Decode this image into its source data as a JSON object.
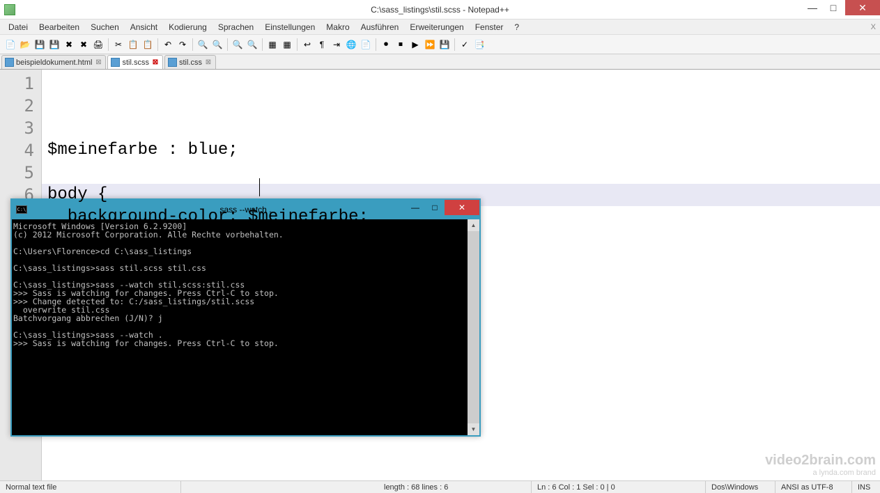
{
  "window": {
    "title": "C:\\sass_listings\\stil.scss - Notepad++"
  },
  "menu": {
    "items": [
      "Datei",
      "Bearbeiten",
      "Suchen",
      "Ansicht",
      "Kodierung",
      "Sprachen",
      "Einstellungen",
      "Makro",
      "Ausführen",
      "Erweiterungen",
      "Fenster",
      "?"
    ],
    "close_x": "X"
  },
  "tabs": [
    {
      "label": "beispieldokument.html",
      "active": false
    },
    {
      "label": "stil.scss",
      "active": true
    },
    {
      "label": "stil.css",
      "active": false
    }
  ],
  "editor": {
    "line_numbers": [
      "1",
      "2",
      "3",
      "4",
      "5",
      "6"
    ],
    "code": "$meinefarbe : blue;\n\nbody {\n  background-color: $meinefarbe;\n}\n",
    "highlight_row": 5
  },
  "statusbar": {
    "lang": "Normal text file",
    "length": "length : 68    lines : 6",
    "pos": "Ln : 6    Col : 1    Sel : 0 | 0",
    "eol": "Dos\\Windows",
    "enc": "ANSI as UTF-8",
    "mode": "INS"
  },
  "console": {
    "title": "sass  --watch .",
    "text": "Microsoft Windows [Version 6.2.9200]\n(c) 2012 Microsoft Corporation. Alle Rechte vorbehalten.\n\nC:\\Users\\Florence>cd C:\\sass_listings\n\nC:\\sass_listings>sass stil.scss stil.css\n\nC:\\sass_listings>sass --watch stil.scss:stil.css\n>>> Sass is watching for changes. Press Ctrl-C to stop.\n>>> Change detected to: C:/sass_listings/stil.scss\n  overwrite stil.css\nBatchvorgang abbrechen (J/N)? j\n\nC:\\sass_listings>sass --watch .\n>>> Sass is watching for changes. Press Ctrl-C to stop.\n"
  },
  "watermark": {
    "line1": "video2brain.com",
    "line2": "a lynda.com brand"
  }
}
